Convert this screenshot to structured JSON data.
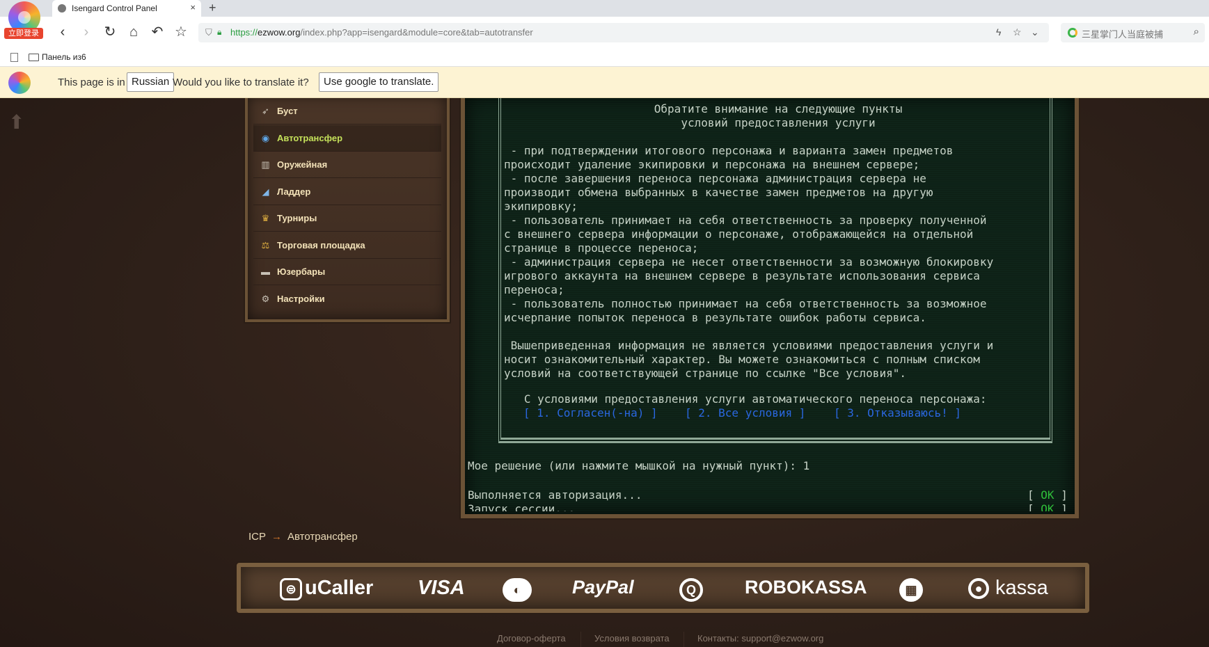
{
  "browser": {
    "login_badge": "立即登录",
    "tab_title": "Isengard Control Panel",
    "tab_close": "×",
    "new_tab": "+",
    "url": {
      "scheme": "https://",
      "domain": "ezwow.org",
      "path": "/index.php?app=isengard&module=core&tab=autotransfer"
    },
    "search_placeholder": "三星掌门人当庭被捕",
    "bookmark_folder": "Панель из6"
  },
  "translate_bar": {
    "prefix": "This page is in",
    "language": "Russian",
    "question": "Would you like to translate it?",
    "button": "Use google to translate."
  },
  "menu": {
    "items": [
      {
        "label": "Буст",
        "icon": "rocket-icon",
        "active": false
      },
      {
        "label": "Автотрансфер",
        "icon": "globe-icon",
        "active": true
      },
      {
        "label": "Оружейная",
        "icon": "armory-icon",
        "active": false
      },
      {
        "label": "Ладдер",
        "icon": "ladder-chart-icon",
        "active": false
      },
      {
        "label": "Турниры",
        "icon": "trophy-icon",
        "active": false
      },
      {
        "label": "Торговая площадка",
        "icon": "scales-icon",
        "active": false
      },
      {
        "label": "Юзербары",
        "icon": "userbar-icon",
        "active": false
      },
      {
        "label": "Настройки",
        "icon": "gear-icon",
        "active": false
      }
    ]
  },
  "terminal": {
    "heading_1": "Обратите внимание на следующие пункты",
    "heading_2": "условий предоставления услуги",
    "body_lines": [
      " - при подтверждении итогового персонажа и варианта замен предметов",
      "происходит удаление экипировки и персонажа на внешнем сервере;",
      " - после завершения переноса персонажа администрация сервера не",
      "производит обмена выбранных в качестве замен предметов на другую",
      "экипировку;",
      " - пользователь принимает на себя ответственность за проверку полученной",
      "с внешнего сервера информации о персонаже, отображающейся на отдельной",
      "странице в процессе переноса;",
      " - администрация сервера не несет ответственности за возможную блокировку",
      "игрового аккаунта на внешнем сервере в результате использования сервиса",
      "переноса;",
      " - пользователь полностью принимает на себя ответственность за возможное",
      "исчерпание попыток переноса в результате ошибок работы сервиса.",
      "",
      " Вышеприведенная информация не является условиями предоставления услуги и",
      "носит ознакомительный характер. Вы можете ознакомиться с полным списком",
      "условий на соответствующей странице по ссылке \"Все условия\"."
    ],
    "prompt": "   С условиями предоставления услуги автоматического переноса персонажа:",
    "options": [
      "[ 1. Согласен(-на) ]",
      "[ 2. Все условия ]",
      "[ 3. Отказываюсь! ]"
    ],
    "decision": "Мое решение (или нажмите мышкой на нужный пункт): 1",
    "status_1": "Выполняется авторизация...",
    "status_2": "Запуск сессии...",
    "ok_open": "[",
    "ok_label": "OK",
    "ok_close": "]"
  },
  "breadcrumb": {
    "root": "ICP",
    "arrow": "→",
    "current": "Автотрансфер"
  },
  "payments": [
    "uCaller",
    "VISA",
    "PayPal",
    "ROBOKASSA",
    "kassa"
  ],
  "footer": {
    "links": [
      "Договор-оферта",
      "Условия возврата",
      "Контакты: support@ezwow.org"
    ]
  }
}
